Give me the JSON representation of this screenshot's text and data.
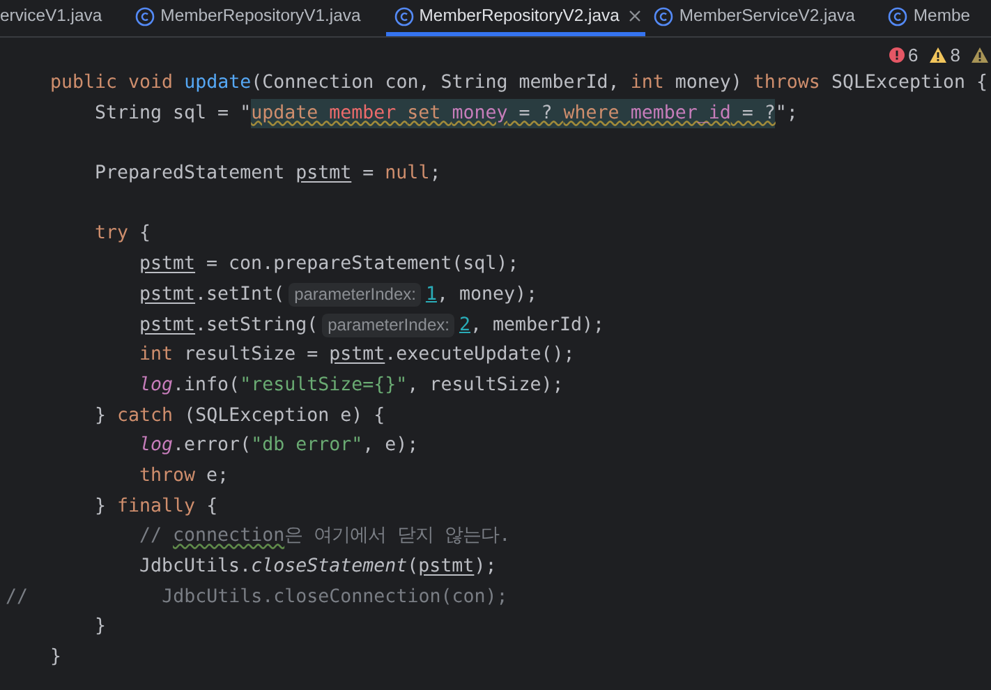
{
  "tabs": [
    {
      "label": "erviceV1.java",
      "selected": false,
      "icon": false,
      "closable": false
    },
    {
      "label": "MemberRepositoryV1.java",
      "selected": false,
      "icon": true,
      "closable": false
    },
    {
      "label": "MemberRepositoryV2.java",
      "selected": true,
      "icon": true,
      "closable": true
    },
    {
      "label": "MemberServiceV2.java",
      "selected": false,
      "icon": true,
      "closable": false
    },
    {
      "label": "Membe",
      "selected": false,
      "icon": true,
      "closable": false
    }
  ],
  "inspections": [
    {
      "kind": "error",
      "count": "6"
    },
    {
      "kind": "warning",
      "count": "8"
    },
    {
      "kind": "weak-warning"
    }
  ],
  "lines": [
    {
      "kind": "code",
      "tokens": [
        {
          "kind": "kw",
          "text": "public void "
        },
        {
          "kind": "fn",
          "text": "update"
        },
        {
          "kind": "plain",
          "text": "(Connection con, String memberId, "
        },
        {
          "kind": "kw",
          "text": "int "
        },
        {
          "kind": "plain",
          "text": "money) "
        },
        {
          "kind": "kw",
          "text": "throws "
        },
        {
          "kind": "plain",
          "text": "SQLException {"
        }
      ],
      "children": [
        {
          "kind": "code",
          "tokens": [
            {
              "kind": "plain",
              "text": "String sql = \""
            },
            {
              "kind": "sql-kw",
              "text": "update "
            },
            {
              "kind": "sql-table",
              "text": "member "
            },
            {
              "kind": "sql-kw",
              "text": "set "
            },
            {
              "kind": "sql-col",
              "text": "money"
            },
            {
              "kind": "sql-op",
              "text": " = ? "
            },
            {
              "kind": "sql-kw",
              "text": "where "
            },
            {
              "kind": "sql-col",
              "text": "member_id"
            },
            {
              "kind": "sql-op",
              "text": " = ?"
            },
            {
              "kind": "plain",
              "text": "\";"
            }
          ]
        },
        {
          "kind": "blank"
        },
        {
          "kind": "code",
          "tokens": [
            {
              "kind": "plain",
              "text": "PreparedStatement "
            },
            {
              "kind": "var",
              "text": "pstmt"
            },
            {
              "kind": "plain",
              "text": " = "
            },
            {
              "kind": "kw",
              "text": "null"
            },
            {
              "kind": "plain",
              "text": ";"
            }
          ]
        },
        {
          "kind": "blank"
        },
        {
          "kind": "code",
          "tokens": [
            {
              "kind": "kw",
              "text": "try "
            },
            {
              "kind": "plain",
              "text": "{"
            }
          ],
          "children": [
            {
              "kind": "code",
              "tokens": [
                {
                  "kind": "var",
                  "text": "pstmt"
                },
                {
                  "kind": "plain",
                  "text": " = con.prepareStatement(sql);"
                }
              ]
            },
            {
              "kind": "code",
              "tokens": [
                {
                  "kind": "var",
                  "text": "pstmt"
                },
                {
                  "kind": "plain",
                  "text": ".setInt("
                },
                {
                  "kind": "hint",
                  "text": "parameterIndex:"
                },
                {
                  "kind": "num",
                  "text": "1"
                },
                {
                  "kind": "plain",
                  "text": ", money);"
                }
              ]
            },
            {
              "kind": "code",
              "tokens": [
                {
                  "kind": "var",
                  "text": "pstmt"
                },
                {
                  "kind": "plain",
                  "text": ".setString("
                },
                {
                  "kind": "hint",
                  "text": "parameterIndex:"
                },
                {
                  "kind": "num",
                  "text": "2"
                },
                {
                  "kind": "plain",
                  "text": ", memberId);"
                }
              ]
            },
            {
              "kind": "code",
              "tokens": [
                {
                  "kind": "kw",
                  "text": "int "
                },
                {
                  "kind": "plain",
                  "text": "resultSize = "
                },
                {
                  "kind": "var",
                  "text": "pstmt"
                },
                {
                  "kind": "plain",
                  "text": ".executeUpdate();"
                }
              ]
            },
            {
              "kind": "code",
              "tokens": [
                {
                  "kind": "field",
                  "text": "log"
                },
                {
                  "kind": "plain",
                  "text": ".info("
                },
                {
                  "kind": "str",
                  "text": "\"resultSize={}\""
                },
                {
                  "kind": "plain",
                  "text": ", resultSize);"
                }
              ]
            }
          ]
        },
        {
          "kind": "code",
          "tokens": [
            {
              "kind": "plain",
              "text": "} "
            },
            {
              "kind": "kw",
              "text": "catch "
            },
            {
              "kind": "plain",
              "text": "(SQLException e) {"
            }
          ],
          "children": [
            {
              "kind": "code",
              "tokens": [
                {
                  "kind": "field",
                  "text": "log"
                },
                {
                  "kind": "plain",
                  "text": ".error("
                },
                {
                  "kind": "str",
                  "text": "\"db error\""
                },
                {
                  "kind": "plain",
                  "text": ", e);"
                }
              ]
            },
            {
              "kind": "code",
              "tokens": [
                {
                  "kind": "kw",
                  "text": "throw "
                },
                {
                  "kind": "plain",
                  "text": "e;"
                }
              ]
            }
          ]
        },
        {
          "kind": "code",
          "tokens": [
            {
              "kind": "plain",
              "text": "} "
            },
            {
              "kind": "kw",
              "text": "finally "
            },
            {
              "kind": "plain",
              "text": "{"
            }
          ],
          "children": [
            {
              "kind": "code",
              "tokens": [
                {
                  "kind": "comment",
                  "text": "// "
                },
                {
                  "kind": "comment-typo",
                  "text": "connection"
                },
                {
                  "kind": "comment",
                  "text": "은 여기에서 닫지 않는다."
                }
              ]
            },
            {
              "kind": "code",
              "tokens": [
                {
                  "kind": "plain",
                  "text": "JdbcUtils."
                },
                {
                  "kind": "static",
                  "text": "closeStatement"
                },
                {
                  "kind": "plain",
                  "text": "("
                },
                {
                  "kind": "var",
                  "text": "pstmt"
                },
                {
                  "kind": "plain",
                  "text": ");"
                }
              ]
            },
            {
              "kind": "commented-out",
              "tokens": [
                {
                  "kind": "comment",
                  "text": "//            JdbcUtils.closeConnection(con);"
                }
              ]
            }
          ]
        },
        {
          "kind": "code",
          "tokens": [
            {
              "kind": "plain",
              "text": "}"
            }
          ]
        }
      ]
    },
    {
      "kind": "code",
      "tokens": [
        {
          "kind": "plain",
          "text": "}"
        }
      ]
    }
  ]
}
